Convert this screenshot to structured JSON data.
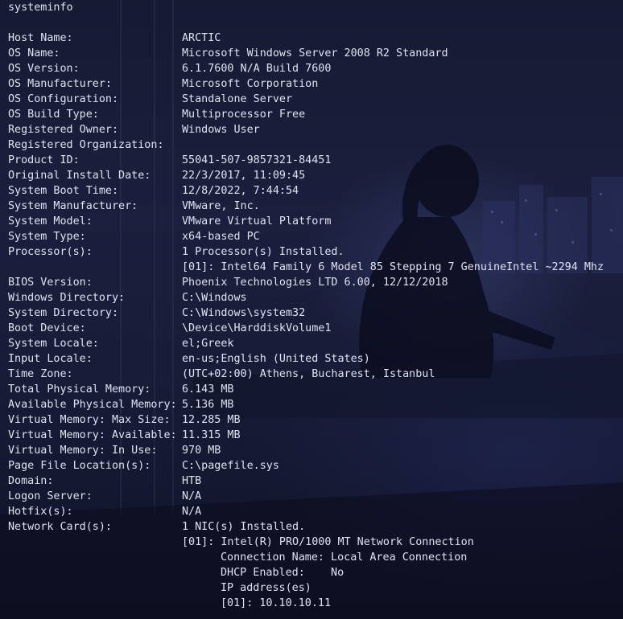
{
  "command": "systeminfo",
  "rows": [
    {
      "label": "Host Name:",
      "value": "ARCTIC"
    },
    {
      "label": "OS Name:",
      "value": "Microsoft Windows Server 2008 R2 Standard"
    },
    {
      "label": "OS Version:",
      "value": "6.1.7600 N/A Build 7600"
    },
    {
      "label": "OS Manufacturer:",
      "value": "Microsoft Corporation"
    },
    {
      "label": "OS Configuration:",
      "value": "Standalone Server"
    },
    {
      "label": "OS Build Type:",
      "value": "Multiprocessor Free"
    },
    {
      "label": "Registered Owner:",
      "value": "Windows User"
    },
    {
      "label": "Registered Organization:",
      "value": ""
    },
    {
      "label": "Product ID:",
      "value": "55041-507-9857321-84451"
    },
    {
      "label": "Original Install Date:",
      "value": "22/3/2017, 11:09:45"
    },
    {
      "label": "System Boot Time:",
      "value": "12/8/2022, 7:44:54"
    },
    {
      "label": "System Manufacturer:",
      "value": "VMware, Inc."
    },
    {
      "label": "System Model:",
      "value": "VMware Virtual Platform"
    },
    {
      "label": "System Type:",
      "value": "x64-based PC"
    },
    {
      "label": "Processor(s):",
      "value": "1 Processor(s) Installed."
    },
    {
      "label": "",
      "value": "[01]: Intel64 Family 6 Model 85 Stepping 7 GenuineIntel ~2294 Mhz"
    },
    {
      "label": "BIOS Version:",
      "value": "Phoenix Technologies LTD 6.00, 12/12/2018"
    },
    {
      "label": "Windows Directory:",
      "value": "C:\\Windows"
    },
    {
      "label": "System Directory:",
      "value": "C:\\Windows\\system32"
    },
    {
      "label": "Boot Device:",
      "value": "\\Device\\HarddiskVolume1"
    },
    {
      "label": "System Locale:",
      "value": "el;Greek"
    },
    {
      "label": "Input Locale:",
      "value": "en-us;English (United States)"
    },
    {
      "label": "Time Zone:",
      "value": "(UTC+02:00) Athens, Bucharest, Istanbul"
    },
    {
      "label": "Total Physical Memory:",
      "value": "6.143 MB"
    },
    {
      "label": "Available Physical Memory:",
      "value": "5.136 MB"
    },
    {
      "label": "Virtual Memory: Max Size:",
      "value": "12.285 MB"
    },
    {
      "label": "Virtual Memory: Available:",
      "value": "11.315 MB"
    },
    {
      "label": "Virtual Memory: In Use:",
      "value": "970 MB"
    },
    {
      "label": "Page File Location(s):",
      "value": "C:\\pagefile.sys"
    },
    {
      "label": "Domain:",
      "value": "HTB"
    },
    {
      "label": "Logon Server:",
      "value": "N/A"
    },
    {
      "label": "Hotfix(s):",
      "value": "N/A"
    },
    {
      "label": "Network Card(s):",
      "value": "1 NIC(s) Installed."
    },
    {
      "label": "",
      "value": "[01]: Intel(R) PRO/1000 MT Network Connection"
    }
  ],
  "nic_details": [
    "Connection Name: Local Area Connection",
    "DHCP Enabled:    No",
    "IP address(es)",
    "[01]: 10.10.10.11"
  ]
}
